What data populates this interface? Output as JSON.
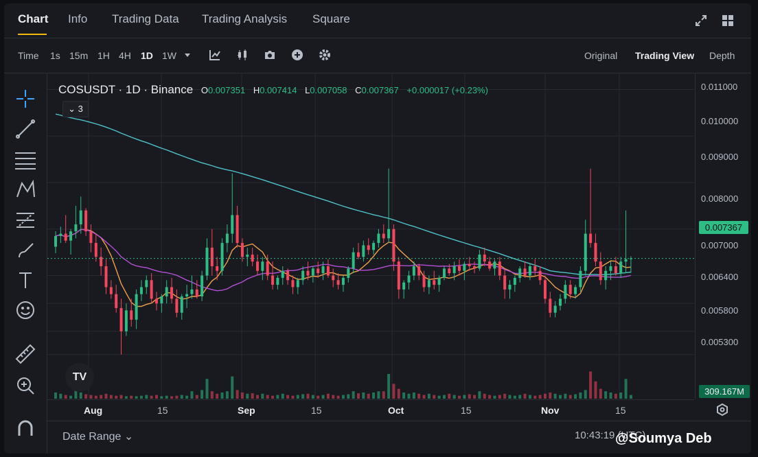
{
  "tabs": [
    {
      "label": "Chart",
      "active": true
    },
    {
      "label": "Info"
    },
    {
      "label": "Trading Data"
    },
    {
      "label": "Trading Analysis"
    },
    {
      "label": "Square"
    }
  ],
  "toolbar": {
    "intervals": [
      "Time",
      "1s",
      "15m",
      "1H",
      "4H",
      "1D",
      "1W"
    ],
    "active_interval": "1D",
    "views": [
      "Original",
      "Trading View",
      "Depth"
    ],
    "active_view": "Trading View"
  },
  "legend": {
    "symbol": "COSUSDT · 1D · Binance",
    "open_label": "O",
    "open": "0.007351",
    "high_label": "H",
    "high": "0.007414",
    "low_label": "L",
    "low": "0.007058",
    "close_label": "C",
    "close": "0.007367",
    "change": "+0.000017 (+0.23%)",
    "indicator_count": "3"
  },
  "price_axis": {
    "labels": [
      "0.011000",
      "0.010000",
      "0.009000",
      "0.008000",
      "0.007000",
      "0.006400",
      "0.005800",
      "0.005300"
    ],
    "last_price": "0.007367",
    "volume": "309.167M"
  },
  "time_axis": {
    "labels": [
      "Aug",
      "15",
      "Sep",
      "15",
      "Oct",
      "15",
      "Nov",
      "15"
    ]
  },
  "footer": {
    "date_range": "Date Range",
    "clock": "10:43:19 (UTC)",
    "watermark": "@Soumya Deb"
  },
  "colors": {
    "up": "#2ebd85",
    "down": "#f6465d",
    "ma_short": "#f0a14a",
    "ma_mid": "#b44fd6",
    "ma_long": "#4fc3c7",
    "accent": "#f0b90b"
  },
  "chart_data": {
    "type": "candlestick",
    "symbol": "COSUSDT",
    "interval": "1D",
    "ylim": [
      0.005,
      0.0112
    ],
    "candles": [
      [
        0.00762,
        0.00795,
        0.00748,
        0.00785
      ],
      [
        0.00785,
        0.00805,
        0.0077,
        0.0079
      ],
      [
        0.0079,
        0.0083,
        0.0077,
        0.00775
      ],
      [
        0.00775,
        0.008,
        0.00745,
        0.00795
      ],
      [
        0.00795,
        0.0085,
        0.0078,
        0.0081
      ],
      [
        0.0081,
        0.0087,
        0.0079,
        0.0084
      ],
      [
        0.0084,
        0.00845,
        0.00785,
        0.00795
      ],
      [
        0.00795,
        0.0081,
        0.0075,
        0.0077
      ],
      [
        0.0077,
        0.0079,
        0.0073,
        0.0074
      ],
      [
        0.0074,
        0.0076,
        0.007,
        0.0072
      ],
      [
        0.0072,
        0.00735,
        0.0066,
        0.00675
      ],
      [
        0.00675,
        0.0069,
        0.0065,
        0.0066
      ],
      [
        0.0066,
        0.0068,
        0.0062,
        0.0063
      ],
      [
        0.0063,
        0.0065,
        0.0053,
        0.0058
      ],
      [
        0.0058,
        0.0064,
        0.0057,
        0.00625
      ],
      [
        0.00625,
        0.0065,
        0.0059,
        0.00605
      ],
      [
        0.00605,
        0.0067,
        0.00585,
        0.0066
      ],
      [
        0.0066,
        0.0069,
        0.00645,
        0.00675
      ],
      [
        0.00675,
        0.007,
        0.0066,
        0.0069
      ],
      [
        0.0069,
        0.00705,
        0.0064,
        0.0065
      ],
      [
        0.0065,
        0.00665,
        0.00625,
        0.0064
      ],
      [
        0.0064,
        0.0066,
        0.0062,
        0.00655
      ],
      [
        0.00655,
        0.0069,
        0.0064,
        0.00675
      ],
      [
        0.00675,
        0.00695,
        0.0064,
        0.0065
      ],
      [
        0.0065,
        0.0067,
        0.0061,
        0.0062
      ],
      [
        0.0062,
        0.0066,
        0.00605,
        0.00655
      ],
      [
        0.00655,
        0.0068,
        0.0063,
        0.0066
      ],
      [
        0.0066,
        0.007,
        0.0065,
        0.0067
      ],
      [
        0.0067,
        0.0069,
        0.0065,
        0.00655
      ],
      [
        0.00655,
        0.0071,
        0.00645,
        0.007
      ],
      [
        0.007,
        0.0078,
        0.0069,
        0.0076
      ],
      [
        0.0076,
        0.008,
        0.007,
        0.0072
      ],
      [
        0.0072,
        0.0074,
        0.0069,
        0.0071
      ],
      [
        0.0071,
        0.0078,
        0.007,
        0.0077
      ],
      [
        0.0077,
        0.0081,
        0.0075,
        0.0079
      ],
      [
        0.0079,
        0.0092,
        0.0077,
        0.0083
      ],
      [
        0.0083,
        0.0085,
        0.0076,
        0.0077
      ],
      [
        0.0077,
        0.0078,
        0.0073,
        0.0074
      ],
      [
        0.0074,
        0.0076,
        0.0072,
        0.00745
      ],
      [
        0.00745,
        0.0076,
        0.0072,
        0.0073
      ],
      [
        0.0073,
        0.00745,
        0.007,
        0.0071
      ],
      [
        0.0071,
        0.0074,
        0.0069,
        0.0073
      ],
      [
        0.0073,
        0.00745,
        0.0069,
        0.007
      ],
      [
        0.007,
        0.0073,
        0.0067,
        0.0068
      ],
      [
        0.0068,
        0.007,
        0.0067,
        0.00695
      ],
      [
        0.00695,
        0.0072,
        0.0068,
        0.0071
      ],
      [
        0.0071,
        0.00715,
        0.0068,
        0.0069
      ],
      [
        0.0069,
        0.007,
        0.0066,
        0.00675
      ],
      [
        0.00675,
        0.00695,
        0.0066,
        0.0069
      ],
      [
        0.0069,
        0.0072,
        0.0068,
        0.0071
      ],
      [
        0.0071,
        0.0073,
        0.0069,
        0.007
      ],
      [
        0.007,
        0.0072,
        0.00685,
        0.00715
      ],
      [
        0.00715,
        0.0073,
        0.00695,
        0.00705
      ],
      [
        0.00705,
        0.0073,
        0.0069,
        0.0072
      ],
      [
        0.0072,
        0.00735,
        0.00695,
        0.007
      ],
      [
        0.007,
        0.00715,
        0.00675,
        0.0069
      ],
      [
        0.0069,
        0.00705,
        0.0067,
        0.0068
      ],
      [
        0.0068,
        0.007,
        0.00665,
        0.00695
      ],
      [
        0.00695,
        0.0072,
        0.00685,
        0.00715
      ],
      [
        0.00715,
        0.0076,
        0.00705,
        0.0075
      ],
      [
        0.0075,
        0.0077,
        0.00735,
        0.0074
      ],
      [
        0.0074,
        0.00775,
        0.0073,
        0.00765
      ],
      [
        0.00765,
        0.0078,
        0.00745,
        0.00755
      ],
      [
        0.00755,
        0.00775,
        0.00745,
        0.0077
      ],
      [
        0.0077,
        0.008,
        0.0076,
        0.0079
      ],
      [
        0.0079,
        0.0081,
        0.0077,
        0.0078
      ],
      [
        0.0078,
        0.0093,
        0.0077,
        0.008
      ],
      [
        0.008,
        0.0081,
        0.0071,
        0.0073
      ],
      [
        0.0073,
        0.0074,
        0.0065,
        0.0067
      ],
      [
        0.0067,
        0.0069,
        0.0065,
        0.00685
      ],
      [
        0.00685,
        0.0071,
        0.0067,
        0.007
      ],
      [
        0.007,
        0.0073,
        0.0069,
        0.0072
      ],
      [
        0.0072,
        0.00725,
        0.0069,
        0.007
      ],
      [
        0.007,
        0.0071,
        0.00665,
        0.00675
      ],
      [
        0.00675,
        0.007,
        0.0066,
        0.0069
      ],
      [
        0.0069,
        0.0071,
        0.0067,
        0.0068
      ],
      [
        0.0068,
        0.007,
        0.00665,
        0.00695
      ],
      [
        0.00695,
        0.0072,
        0.0069,
        0.00715
      ],
      [
        0.00715,
        0.00725,
        0.007,
        0.00705
      ],
      [
        0.00705,
        0.0073,
        0.0069,
        0.0072
      ],
      [
        0.0072,
        0.00735,
        0.007,
        0.0071
      ],
      [
        0.0071,
        0.0073,
        0.0069,
        0.00725
      ],
      [
        0.00725,
        0.0074,
        0.0071,
        0.0072
      ],
      [
        0.0072,
        0.0073,
        0.00705,
        0.00715
      ],
      [
        0.00715,
        0.00755,
        0.0071,
        0.00745
      ],
      [
        0.00745,
        0.0076,
        0.0072,
        0.0073
      ],
      [
        0.0073,
        0.0074,
        0.0071,
        0.00715
      ],
      [
        0.00715,
        0.00735,
        0.007,
        0.0073
      ],
      [
        0.0073,
        0.0074,
        0.0069,
        0.007
      ],
      [
        0.007,
        0.00715,
        0.0065,
        0.0067
      ],
      [
        0.0067,
        0.0069,
        0.0065,
        0.0068
      ],
      [
        0.0068,
        0.007,
        0.00665,
        0.00695
      ],
      [
        0.00695,
        0.0072,
        0.00685,
        0.00715
      ],
      [
        0.00715,
        0.0073,
        0.00695,
        0.007
      ],
      [
        0.007,
        0.00725,
        0.0069,
        0.0072
      ],
      [
        0.0072,
        0.00735,
        0.007,
        0.0071
      ],
      [
        0.0071,
        0.0072,
        0.0068,
        0.0069
      ],
      [
        0.0069,
        0.007,
        0.0064,
        0.0065
      ],
      [
        0.0065,
        0.00665,
        0.0061,
        0.0062
      ],
      [
        0.0062,
        0.00645,
        0.0061,
        0.00635
      ],
      [
        0.00635,
        0.0066,
        0.00625,
        0.0065
      ],
      [
        0.0065,
        0.0069,
        0.0064,
        0.0068
      ],
      [
        0.0068,
        0.0069,
        0.0065,
        0.0066
      ],
      [
        0.0066,
        0.0068,
        0.0065,
        0.00675
      ],
      [
        0.00675,
        0.0072,
        0.00665,
        0.0071
      ],
      [
        0.0071,
        0.0082,
        0.007,
        0.0079
      ],
      [
        0.0079,
        0.0093,
        0.0076,
        0.0077
      ],
      [
        0.0077,
        0.0079,
        0.0072,
        0.0073
      ],
      [
        0.0073,
        0.0075,
        0.0068,
        0.0069
      ],
      [
        0.0069,
        0.0072,
        0.0067,
        0.0071
      ],
      [
        0.0071,
        0.0073,
        0.0069,
        0.0072
      ],
      [
        0.0072,
        0.0074,
        0.007,
        0.00705
      ],
      [
        0.00705,
        0.0074,
        0.00695,
        0.0073
      ],
      [
        0.0073,
        0.0084,
        0.00705,
        0.00735
      ],
      [
        0.007351,
        0.007414,
        0.007058,
        0.007367
      ]
    ],
    "volume_relative": [
      0.25,
      0.2,
      0.15,
      0.12,
      0.6,
      0.25,
      0.18,
      0.15,
      0.12,
      0.15,
      0.2,
      0.15,
      0.12,
      0.15,
      0.1,
      0.12,
      0.1,
      0.12,
      0.15,
      0.12,
      0.15,
      0.1,
      0.12,
      0.1,
      0.12,
      0.15,
      0.12,
      0.3,
      0.15,
      0.35,
      0.8,
      0.3,
      0.2,
      0.25,
      0.3,
      0.9,
      0.35,
      0.25,
      0.2,
      0.22,
      0.15,
      0.2,
      0.15,
      0.12,
      0.15,
      0.2,
      0.15,
      0.12,
      0.15,
      0.18,
      0.2,
      0.15,
      0.12,
      0.15,
      0.2,
      0.15,
      0.12,
      0.15,
      0.18,
      0.3,
      0.22,
      0.25,
      0.2,
      0.25,
      0.3,
      0.3,
      1.0,
      0.6,
      0.4,
      0.25,
      0.2,
      0.25,
      0.2,
      0.15,
      0.2,
      0.15,
      0.12,
      0.15,
      0.2,
      0.15,
      0.12,
      0.15,
      0.18,
      0.15,
      0.3,
      0.2,
      0.15,
      0.12,
      0.15,
      0.2,
      0.15,
      0.12,
      0.15,
      0.2,
      0.15,
      0.12,
      0.15,
      0.2,
      0.25,
      0.2,
      0.15,
      0.2,
      0.15,
      0.18,
      0.25,
      0.35,
      1.1,
      0.7,
      0.4,
      0.3,
      0.25,
      0.2,
      0.25,
      0.8,
      0.15
    ]
  }
}
